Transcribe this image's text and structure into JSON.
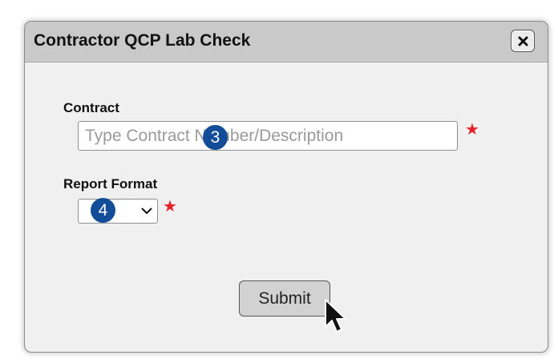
{
  "dialog": {
    "title": "Contractor QCP Lab Check",
    "close_icon": "close-icon"
  },
  "form": {
    "contract": {
      "label": "Contract",
      "placeholder": "Type Contract Number/Description",
      "required_marker": "★"
    },
    "report_format": {
      "label": "Report Format",
      "selected_value": "",
      "required_marker": "★"
    },
    "submit_label": "Submit"
  },
  "step_markers": {
    "contract_step": "3",
    "format_step": "4",
    "color": "#134d99"
  },
  "colors": {
    "required_star": "#e8202a",
    "titlebar": "#c9c9c9",
    "dialog_background": "#f0f0f0"
  },
  "cursor_icon": "arrow-cursor-icon"
}
